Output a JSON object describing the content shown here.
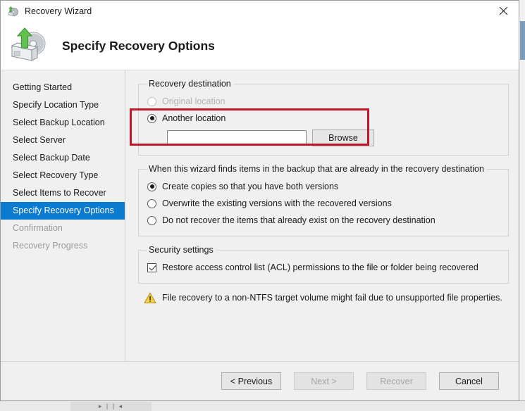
{
  "window": {
    "title": "Recovery Wizard",
    "icon": "recovery-disk-icon",
    "close_label": "✕"
  },
  "header": {
    "title": "Specify Recovery Options",
    "icon": "recovery-disk-large-icon"
  },
  "sidebar": {
    "items": [
      {
        "label": "Getting Started",
        "state": "normal"
      },
      {
        "label": "Specify Location Type",
        "state": "normal"
      },
      {
        "label": "Select Backup Location",
        "state": "normal"
      },
      {
        "label": "Select Server",
        "state": "normal"
      },
      {
        "label": "Select Backup Date",
        "state": "normal"
      },
      {
        "label": "Select Recovery Type",
        "state": "normal"
      },
      {
        "label": "Select Items to Recover",
        "state": "normal"
      },
      {
        "label": "Specify Recovery Options",
        "state": "selected"
      },
      {
        "label": "Confirmation",
        "state": "disabled"
      },
      {
        "label": "Recovery Progress",
        "state": "disabled"
      }
    ],
    "selected_color": "#0b7ad1"
  },
  "main": {
    "destination_group": {
      "legend": "Recovery destination",
      "original_location": {
        "label": "Original location",
        "checked": false,
        "enabled": false
      },
      "another_location": {
        "label": "Another location",
        "checked": true,
        "enabled": true
      },
      "path_input": {
        "value": "",
        "placeholder": ""
      },
      "browse_label": "Browse",
      "annotation_color": "#c1152b"
    },
    "conflict_group": {
      "legend": "When this wizard finds items in the backup that are already in the recovery destination",
      "options": [
        {
          "label": "Create copies so that you have both versions",
          "checked": true
        },
        {
          "label": "Overwrite the existing versions with the recovered versions",
          "checked": false
        },
        {
          "label": "Do not recover the items that already exist on the recovery destination",
          "checked": false
        }
      ]
    },
    "security_group": {
      "legend": "Security settings",
      "acl_checkbox": {
        "label": "Restore access control list (ACL) permissions to the file or folder being recovered",
        "checked": true
      }
    },
    "warning": {
      "icon": "warning-triangle-icon",
      "text": "File recovery to a non-NTFS target volume might fail due to unsupported file properties.",
      "color": "#f0c419"
    }
  },
  "footer": {
    "buttons": [
      {
        "label": "< Previous",
        "enabled": true
      },
      {
        "label": "Next >",
        "enabled": false
      },
      {
        "label": "Recover",
        "enabled": false
      },
      {
        "label": "Cancel",
        "enabled": true
      }
    ]
  },
  "background": {
    "taskbar_fragment": "▸ | | ◂"
  }
}
